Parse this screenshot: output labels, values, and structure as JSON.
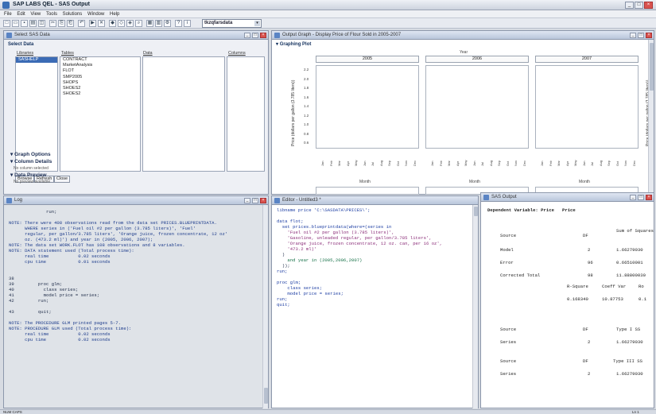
{
  "app": {
    "title": "SAP LABS QEL - SAS Output"
  },
  "menu": [
    "File",
    "Edit",
    "View",
    "Tools",
    "Solutions",
    "Window",
    "Help"
  ],
  "toolbar": {
    "command": "tkzqfarsdata"
  },
  "select_window": {
    "title": "Select SAS Data",
    "section_select": "Select Data",
    "libraries_header": "Libraries",
    "tables_header": "Tables",
    "data_header": "Data",
    "columns_header": "Columns",
    "libraries": [
      "SASHELP"
    ],
    "tables": [
      "CONTRACT",
      "MarketAnalysis",
      "FLOT",
      "SMP2005",
      "SHOPS",
      "SHOES2",
      "SHOES2"
    ],
    "buttons": [
      "Browse",
      "Refresh",
      "Close"
    ],
    "sections": [
      "Graph Options",
      "Column Details",
      "Data Preview"
    ],
    "column_note": "No column selected",
    "preview_note": "No preview available"
  },
  "graph_window": {
    "title": "Output Graph - Display Price of Flour Sold in 2005-2007",
    "section": "Graphing Plot",
    "year_header": "Year",
    "years": [
      "2005",
      "2006",
      "2007"
    ],
    "ylabel": "Price (dollars per gallon (3.785 liters))",
    "yticks": [
      "2.2",
      "2.0",
      "1.8",
      "1.6",
      "1.4",
      "1.2",
      "1.0",
      "0.8",
      "0.6"
    ],
    "xlabel": "Month",
    "months": [
      "Jan",
      "Feb",
      "Mar",
      "Apr",
      "May",
      "Jun",
      "Jul",
      "Aug",
      "Sep",
      "Oct",
      "Nov",
      "Dec"
    ]
  },
  "log_window": {
    "title": "Log",
    "lines": [
      {
        "k": "plain",
        "t": "              run;"
      },
      {
        "k": "plain",
        "t": ""
      },
      {
        "k": "note",
        "t": "NOTE: There were 408 observations read from the data set PRICES.BLUEPRINTDATA."
      },
      {
        "k": "note",
        "t": "      WHERE series in ('Fuel oil #2 per gallon (3.785 liters)', 'Fuel'"
      },
      {
        "k": "note",
        "t": "      regular, per gallon/3.785 liters', 'Orange juice, frozen concentrate, 12 oz'"
      },
      {
        "k": "note",
        "t": "      oz. (473.2 ml)') and year in (2005, 2006, 2007);"
      },
      {
        "k": "note",
        "t": "NOTE: The data set WORK.FLOT has 108 observations and 8 variables."
      },
      {
        "k": "note",
        "t": "NOTE: DATA statement used (Total process time):"
      },
      {
        "k": "note",
        "t": "      real time           0.02 seconds"
      },
      {
        "k": "note",
        "t": "      cpu time            0.01 seconds"
      },
      {
        "k": "plain",
        "t": ""
      },
      {
        "k": "plain",
        "t": ""
      },
      {
        "k": "plain",
        "t": "38"
      },
      {
        "k": "plain",
        "t": "39         proc glm;"
      },
      {
        "k": "plain",
        "t": "40           class series;"
      },
      {
        "k": "plain",
        "t": "41           model price = series;"
      },
      {
        "k": "plain",
        "t": "42         run;"
      },
      {
        "k": "plain",
        "t": ""
      },
      {
        "k": "plain",
        "t": "43         quit;"
      },
      {
        "k": "plain",
        "t": ""
      },
      {
        "k": "note",
        "t": "NOTE: The PROCEDURE GLM printed pages 5-7."
      },
      {
        "k": "note",
        "t": "NOTE: PROCEDURE GLM used (Total process time):"
      },
      {
        "k": "note",
        "t": "      real time           0.02 seconds"
      },
      {
        "k": "note",
        "t": "      cpu time            0.02 seconds"
      }
    ]
  },
  "editor_window": {
    "title": "Editor - Untitled3 *",
    "header_line": "libname price 'C:\\SASDATA\\PRICES\\';",
    "code": [
      "data flot;",
      "  set prices.blueprintdata(where=(series in",
      "    'Fuel oil #2 per gallon (3.785 liters)',",
      "    'Gasoline, unleaded regular, per gallon/3.785 liters',",
      "    'Orange juice, frozen concentrate, 12 oz. can, per 16 oz',",
      "    '473.2 ml)'",
      "  )",
      "    and year in (2005,2006,2007)",
      "  ));",
      "run;",
      "",
      "proc glm;",
      "    class series;",
      "    model price = series;",
      "run;",
      "quit;"
    ]
  },
  "results_window": {
    "title": "SAS Output",
    "dep_var": "Dependent Variable: Price   Price",
    "anova_header": [
      "Source",
      "DF",
      "Sum of Squares"
    ],
    "anova_rows": [
      [
        "Model",
        "2",
        "1.66279030"
      ],
      [
        "Error",
        "96",
        "0.66510001"
      ],
      [
        "Corrected Total",
        "98",
        "11.88800030"
      ]
    ],
    "fit_header": [
      "R-Square",
      "Coeff Var",
      "Ro"
    ],
    "fit_values": [
      "0.168340",
      "10.87753",
      "0.1"
    ],
    "type1_header": [
      "Source",
      "DF",
      "Type I SS"
    ],
    "type1_rows": [
      [
        "Series",
        "2",
        "1.66279030"
      ]
    ],
    "type3_header": [
      "Source",
      "DF",
      "Type III SS"
    ],
    "type3_rows": [
      [
        "Series",
        "2",
        "1.66279030"
      ]
    ]
  },
  "status": {
    "left": "NUM CAPS",
    "right": "Ln 1"
  }
}
